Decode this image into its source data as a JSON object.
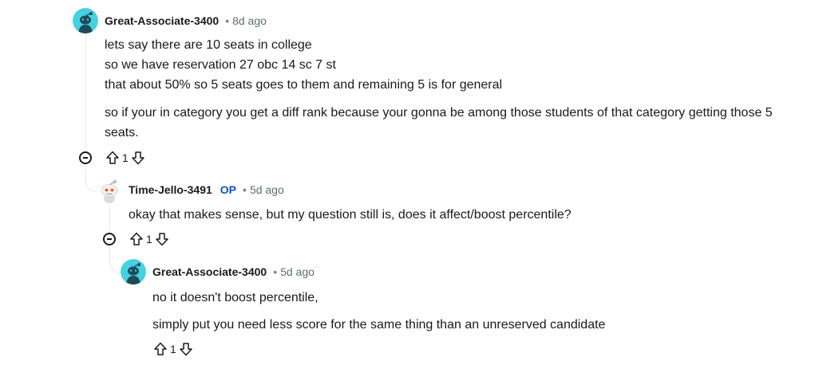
{
  "comments": [
    {
      "author": "Great-Associate-3400",
      "separator": "•",
      "time": "8d ago",
      "paragraphs": [
        "lets say there are 10 seats in college",
        "so we have reservation 27 obc 14 sc 7 st",
        "that about 50% so 5 seats goes to them and remaining 5 is for general",
        "so if your in category you get a diff rank because your gonna be among those students of that category getting those 5 seats."
      ],
      "votes": "1"
    },
    {
      "author": "Time-Jello-3491",
      "badge": "OP",
      "separator": "•",
      "time": "5d ago",
      "paragraphs": [
        "okay that makes sense, but my question still is, does it affect/boost percentile?"
      ],
      "votes": "1"
    },
    {
      "author": "Great-Associate-3400",
      "separator": "•",
      "time": "5d ago",
      "paragraphs": [
        "no it doesn't boost percentile,",
        "simply put you need less score for the same thing than an unreserved candidate"
      ],
      "votes": "1"
    }
  ],
  "colors": {
    "avatar_teal": "#46d1e0",
    "avatar_dark": "#1d4a5a",
    "op_blue": "#0a53be",
    "thread_line": "#e5ebee"
  },
  "icons": {
    "upvote": "arrow-up-outline-icon",
    "downvote": "arrow-down-outline-icon",
    "collapse": "minus-circle-icon",
    "avatar": "snoo-avatar-icon"
  }
}
